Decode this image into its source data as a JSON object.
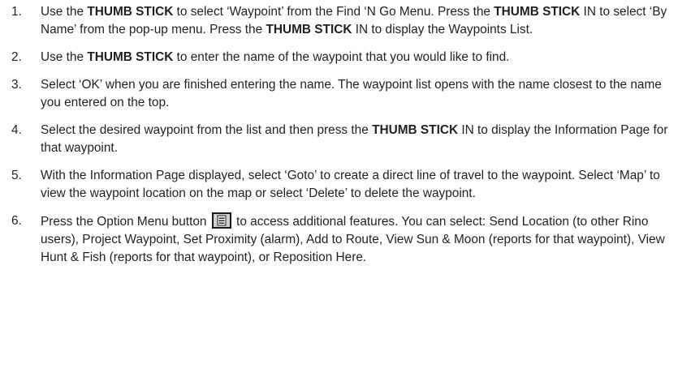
{
  "steps": [
    {
      "num": "1.",
      "parts": [
        {
          "t": "Use the ",
          "b": false
        },
        {
          "t": "THUMB STICK",
          "b": true
        },
        {
          "t": " to select ‘Waypoint’ from the Find ‘N Go Menu.  Press the ",
          "b": false
        },
        {
          "t": "THUMB STICK",
          "b": true
        },
        {
          "t": " IN to select ‘By Name’ from the pop-up menu.  Press the ",
          "b": false
        },
        {
          "t": "THUMB STICK",
          "b": true
        },
        {
          "t": " IN to display the Waypoints List.",
          "b": false
        }
      ]
    },
    {
      "num": "2.",
      "parts": [
        {
          "t": "Use the ",
          "b": false
        },
        {
          "t": "THUMB STICK",
          "b": true
        },
        {
          "t": " to enter the name of the waypoint that you would like to find.",
          "b": false
        }
      ]
    },
    {
      "num": "3.",
      "parts": [
        {
          "t": "Select ‘OK’ when you are finished entering the name.  The waypoint list opens with the name closest to the name you entered on the top.",
          "b": false
        }
      ]
    },
    {
      "num": "4.",
      "parts": [
        {
          "t": "Select the desired waypoint from the list and then press the ",
          "b": false
        },
        {
          "t": "THUMB STICK",
          "b": true
        },
        {
          "t": " IN to display the Information Page for that waypoint.",
          "b": false
        }
      ]
    },
    {
      "num": "5.",
      "parts": [
        {
          "t": "With the Information Page displayed, select ‘Goto’ to create a direct line of travel to the waypoint.  Select ‘Map’ to view the waypoint location on the map or select ‘Delete’ to delete the waypoint.",
          "b": false
        }
      ]
    },
    {
      "num": "6.",
      "parts": [
        {
          "t": "Press the Option Menu button ",
          "b": false
        },
        {
          "icon": "option-menu-icon"
        },
        {
          "t": " to access additional features.  You can select: Send Location (to other Rino users), Project Waypoint, Set Proximity (alarm), Add to Route, View Sun & Moon (reports for that waypoint), View Hunt & Fish (reports for that waypoint), or Reposition Here.",
          "b": false
        }
      ]
    }
  ],
  "colors": {
    "text": "#231f20",
    "icon_bg": "#1a1a1a",
    "icon_face": "#d0d0d0"
  }
}
